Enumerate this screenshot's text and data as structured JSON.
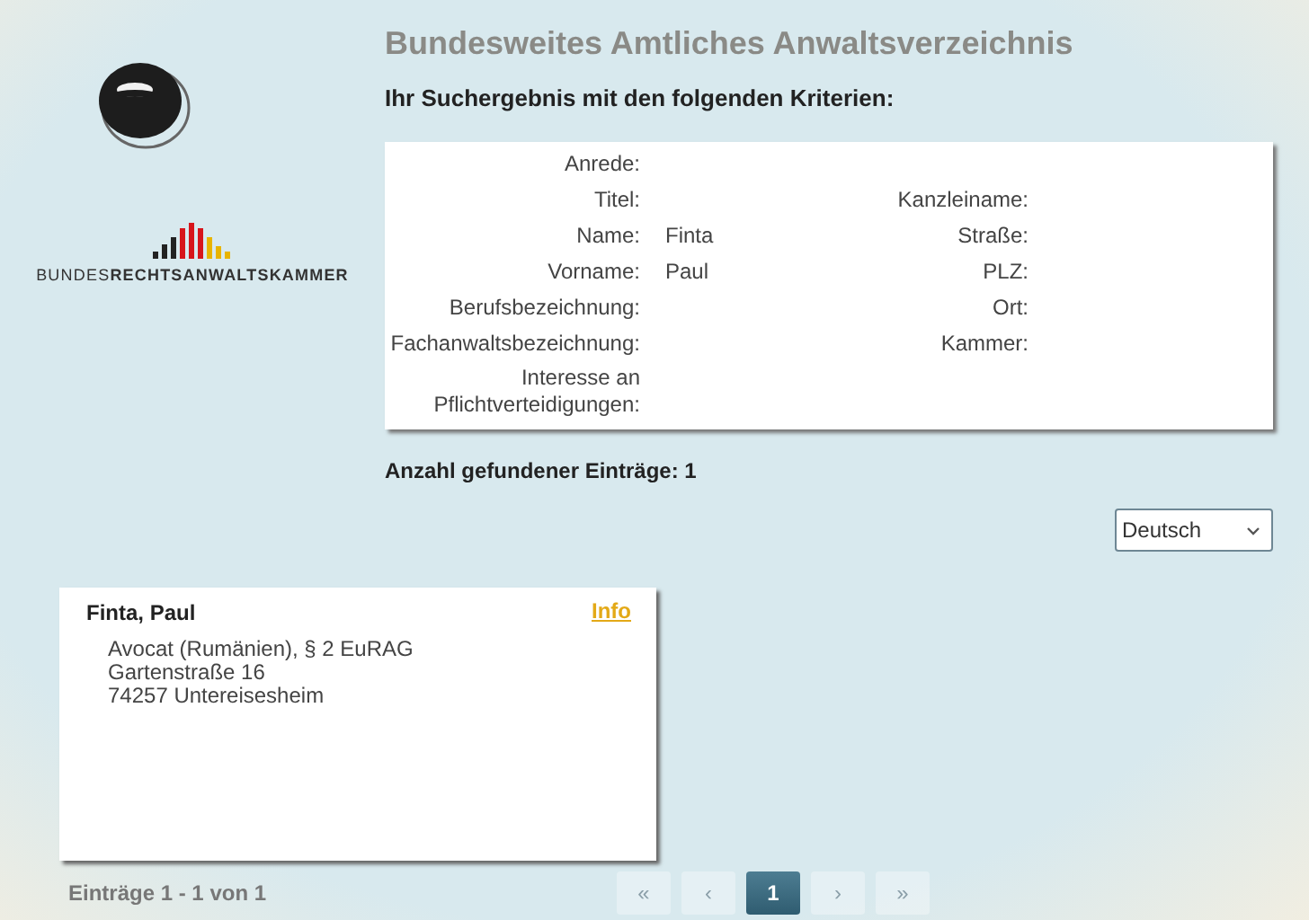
{
  "header": {
    "title": "Bundesweites Amtliches Anwaltsverzeichnis",
    "subtitle": "Ihr Suchergebnis mit den folgenden Kriterien:"
  },
  "logo": {
    "text": "BUNDES**RECHTSANWALTSKAMMER**"
  },
  "criteria": [
    {
      "label": "Anrede:"
    },
    {
      "label": "Titel:",
      "label_2": "Kanzleiname:"
    },
    {
      "label": "Name:",
      "value": "Finta",
      "label_2": "Straße:"
    },
    {
      "label": "Vorname:",
      "value": "Paul",
      "label_2": "PLZ:"
    },
    {
      "label": "Berufsbezeichnung:",
      "label_2": "Ort:"
    },
    {
      "label": "Fachanwaltsbezeichnung:",
      "label_2": "Kammer:"
    },
    {
      "label": "Interesse an Pflichtverteidigungen:"
    }
  ],
  "result_count": "Anzahl gefundener Einträge: 1",
  "language_select": {
    "value": "Deutsch"
  },
  "results": [
    {
      "name": "Finta, Paul",
      "link": "Info",
      "lines": [
        "Avocat (Rumänien), § 2 EuRAG",
        "Gartenstraße 16",
        "74257 Untereisesheim"
      ]
    }
  ],
  "footer": {
    "summary": "Einträge 1 - 1 von 1"
  },
  "pagination": [
    {
      "label": "«",
      "disabled": true,
      "selected": false
    },
    {
      "label": "‹",
      "disabled": true,
      "selected": false
    },
    {
      "label": "1",
      "disabled": false,
      "selected": true
    },
    {
      "label": "›",
      "disabled": true,
      "selected": false
    },
    {
      "label": "»",
      "disabled": true,
      "selected": false
    }
  ]
}
